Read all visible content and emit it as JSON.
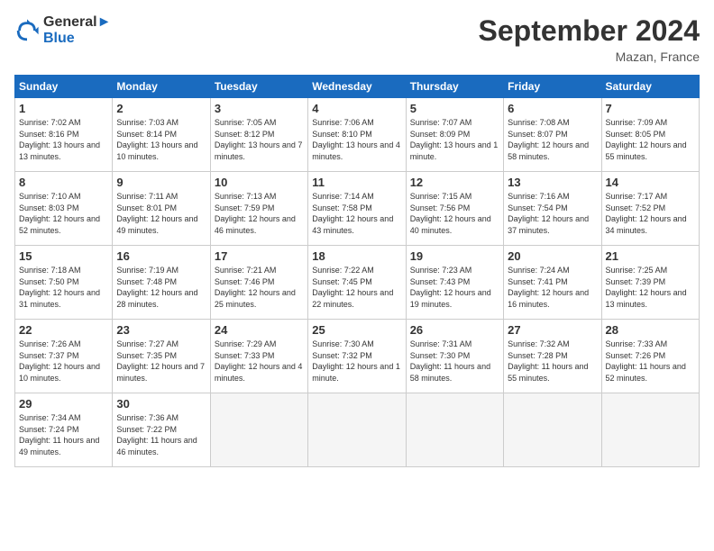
{
  "header": {
    "logo_line1": "General",
    "logo_line2": "Blue",
    "month_title": "September 2024",
    "location": "Mazan, France"
  },
  "weekdays": [
    "Sunday",
    "Monday",
    "Tuesday",
    "Wednesday",
    "Thursday",
    "Friday",
    "Saturday"
  ],
  "weeks": [
    [
      {
        "day": "1",
        "sunrise": "Sunrise: 7:02 AM",
        "sunset": "Sunset: 8:16 PM",
        "daylight": "Daylight: 13 hours and 13 minutes."
      },
      {
        "day": "2",
        "sunrise": "Sunrise: 7:03 AM",
        "sunset": "Sunset: 8:14 PM",
        "daylight": "Daylight: 13 hours and 10 minutes."
      },
      {
        "day": "3",
        "sunrise": "Sunrise: 7:05 AM",
        "sunset": "Sunset: 8:12 PM",
        "daylight": "Daylight: 13 hours and 7 minutes."
      },
      {
        "day": "4",
        "sunrise": "Sunrise: 7:06 AM",
        "sunset": "Sunset: 8:10 PM",
        "daylight": "Daylight: 13 hours and 4 minutes."
      },
      {
        "day": "5",
        "sunrise": "Sunrise: 7:07 AM",
        "sunset": "Sunset: 8:09 PM",
        "daylight": "Daylight: 13 hours and 1 minute."
      },
      {
        "day": "6",
        "sunrise": "Sunrise: 7:08 AM",
        "sunset": "Sunset: 8:07 PM",
        "daylight": "Daylight: 12 hours and 58 minutes."
      },
      {
        "day": "7",
        "sunrise": "Sunrise: 7:09 AM",
        "sunset": "Sunset: 8:05 PM",
        "daylight": "Daylight: 12 hours and 55 minutes."
      }
    ],
    [
      {
        "day": "8",
        "sunrise": "Sunrise: 7:10 AM",
        "sunset": "Sunset: 8:03 PM",
        "daylight": "Daylight: 12 hours and 52 minutes."
      },
      {
        "day": "9",
        "sunrise": "Sunrise: 7:11 AM",
        "sunset": "Sunset: 8:01 PM",
        "daylight": "Daylight: 12 hours and 49 minutes."
      },
      {
        "day": "10",
        "sunrise": "Sunrise: 7:13 AM",
        "sunset": "Sunset: 7:59 PM",
        "daylight": "Daylight: 12 hours and 46 minutes."
      },
      {
        "day": "11",
        "sunrise": "Sunrise: 7:14 AM",
        "sunset": "Sunset: 7:58 PM",
        "daylight": "Daylight: 12 hours and 43 minutes."
      },
      {
        "day": "12",
        "sunrise": "Sunrise: 7:15 AM",
        "sunset": "Sunset: 7:56 PM",
        "daylight": "Daylight: 12 hours and 40 minutes."
      },
      {
        "day": "13",
        "sunrise": "Sunrise: 7:16 AM",
        "sunset": "Sunset: 7:54 PM",
        "daylight": "Daylight: 12 hours and 37 minutes."
      },
      {
        "day": "14",
        "sunrise": "Sunrise: 7:17 AM",
        "sunset": "Sunset: 7:52 PM",
        "daylight": "Daylight: 12 hours and 34 minutes."
      }
    ],
    [
      {
        "day": "15",
        "sunrise": "Sunrise: 7:18 AM",
        "sunset": "Sunset: 7:50 PM",
        "daylight": "Daylight: 12 hours and 31 minutes."
      },
      {
        "day": "16",
        "sunrise": "Sunrise: 7:19 AM",
        "sunset": "Sunset: 7:48 PM",
        "daylight": "Daylight: 12 hours and 28 minutes."
      },
      {
        "day": "17",
        "sunrise": "Sunrise: 7:21 AM",
        "sunset": "Sunset: 7:46 PM",
        "daylight": "Daylight: 12 hours and 25 minutes."
      },
      {
        "day": "18",
        "sunrise": "Sunrise: 7:22 AM",
        "sunset": "Sunset: 7:45 PM",
        "daylight": "Daylight: 12 hours and 22 minutes."
      },
      {
        "day": "19",
        "sunrise": "Sunrise: 7:23 AM",
        "sunset": "Sunset: 7:43 PM",
        "daylight": "Daylight: 12 hours and 19 minutes."
      },
      {
        "day": "20",
        "sunrise": "Sunrise: 7:24 AM",
        "sunset": "Sunset: 7:41 PM",
        "daylight": "Daylight: 12 hours and 16 minutes."
      },
      {
        "day": "21",
        "sunrise": "Sunrise: 7:25 AM",
        "sunset": "Sunset: 7:39 PM",
        "daylight": "Daylight: 12 hours and 13 minutes."
      }
    ],
    [
      {
        "day": "22",
        "sunrise": "Sunrise: 7:26 AM",
        "sunset": "Sunset: 7:37 PM",
        "daylight": "Daylight: 12 hours and 10 minutes."
      },
      {
        "day": "23",
        "sunrise": "Sunrise: 7:27 AM",
        "sunset": "Sunset: 7:35 PM",
        "daylight": "Daylight: 12 hours and 7 minutes."
      },
      {
        "day": "24",
        "sunrise": "Sunrise: 7:29 AM",
        "sunset": "Sunset: 7:33 PM",
        "daylight": "Daylight: 12 hours and 4 minutes."
      },
      {
        "day": "25",
        "sunrise": "Sunrise: 7:30 AM",
        "sunset": "Sunset: 7:32 PM",
        "daylight": "Daylight: 12 hours and 1 minute."
      },
      {
        "day": "26",
        "sunrise": "Sunrise: 7:31 AM",
        "sunset": "Sunset: 7:30 PM",
        "daylight": "Daylight: 11 hours and 58 minutes."
      },
      {
        "day": "27",
        "sunrise": "Sunrise: 7:32 AM",
        "sunset": "Sunset: 7:28 PM",
        "daylight": "Daylight: 11 hours and 55 minutes."
      },
      {
        "day": "28",
        "sunrise": "Sunrise: 7:33 AM",
        "sunset": "Sunset: 7:26 PM",
        "daylight": "Daylight: 11 hours and 52 minutes."
      }
    ],
    [
      {
        "day": "29",
        "sunrise": "Sunrise: 7:34 AM",
        "sunset": "Sunset: 7:24 PM",
        "daylight": "Daylight: 11 hours and 49 minutes."
      },
      {
        "day": "30",
        "sunrise": "Sunrise: 7:36 AM",
        "sunset": "Sunset: 7:22 PM",
        "daylight": "Daylight: 11 hours and 46 minutes."
      },
      null,
      null,
      null,
      null,
      null
    ]
  ]
}
